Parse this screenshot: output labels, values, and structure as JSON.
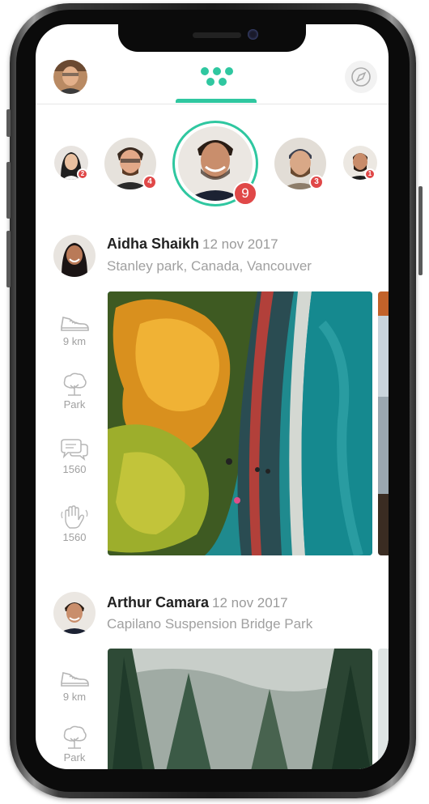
{
  "header": {
    "profile_icon": "user-avatar",
    "tab_icon": "dots-grid-icon",
    "compass_icon": "compass-icon",
    "accent": "#2fc7a0"
  },
  "stories": [
    {
      "badge": "2"
    },
    {
      "badge": "4"
    },
    {
      "badge": "9",
      "active": true
    },
    {
      "badge": "3"
    },
    {
      "badge": "1"
    }
  ],
  "posts": [
    {
      "name": "Aidha Shaikh",
      "date": "12 nov 2017",
      "location": "Stanley park, Canada, Vancouver",
      "stats": [
        {
          "icon": "shoe-icon",
          "value": "9 km"
        },
        {
          "icon": "tree-icon",
          "value": "Park"
        },
        {
          "icon": "comments-icon",
          "value": "1560"
        },
        {
          "icon": "hand-wave-icon",
          "value": "1560"
        }
      ]
    },
    {
      "name": "Arthur Camara",
      "date": "12 nov 2017",
      "location": "Capilano Suspension Bridge Park",
      "stats": [
        {
          "icon": "shoe-icon",
          "value": "9 km"
        },
        {
          "icon": "tree-icon",
          "value": "Park"
        }
      ]
    }
  ],
  "colors": {
    "badge": "#e04848",
    "accent": "#2fc7a0",
    "muted": "#a0a0a0"
  }
}
